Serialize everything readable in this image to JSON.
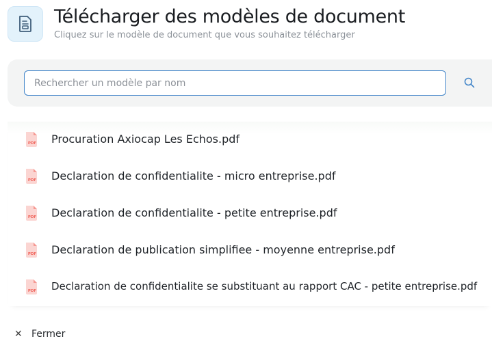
{
  "header": {
    "icon": "document-icon",
    "title": "Télécharger des modèles de document",
    "subtitle": "Cliquez sur le modèle de document que vous souhaitez télécharger"
  },
  "search": {
    "placeholder": "Rechercher un modèle par nom",
    "value": "",
    "button_icon": "search-icon"
  },
  "files": [
    {
      "name": "Procuration Axiocap Les Echos.pdf",
      "icon": "pdf-file-icon"
    },
    {
      "name": "Declaration de confidentialite - micro entreprise.pdf",
      "icon": "pdf-file-icon"
    },
    {
      "name": "Declaration de confidentialite - petite entreprise.pdf",
      "icon": "pdf-file-icon"
    },
    {
      "name": "Declaration de publication simplifiee - moyenne entreprise.pdf",
      "icon": "pdf-file-icon"
    },
    {
      "name": "Declaration de confidentialite se substituant au rapport CAC - petite entreprise.pdf",
      "icon": "pdf-file-icon"
    }
  ],
  "footer": {
    "close_icon": "close-icon",
    "close_label": "Fermer"
  },
  "colors": {
    "accent": "#3f83c8",
    "pdf_red": "#f0685f",
    "pdf_light": "#fbd5d2",
    "icon_bg": "#e3f2fb",
    "band_bg": "#f3f4f4"
  }
}
